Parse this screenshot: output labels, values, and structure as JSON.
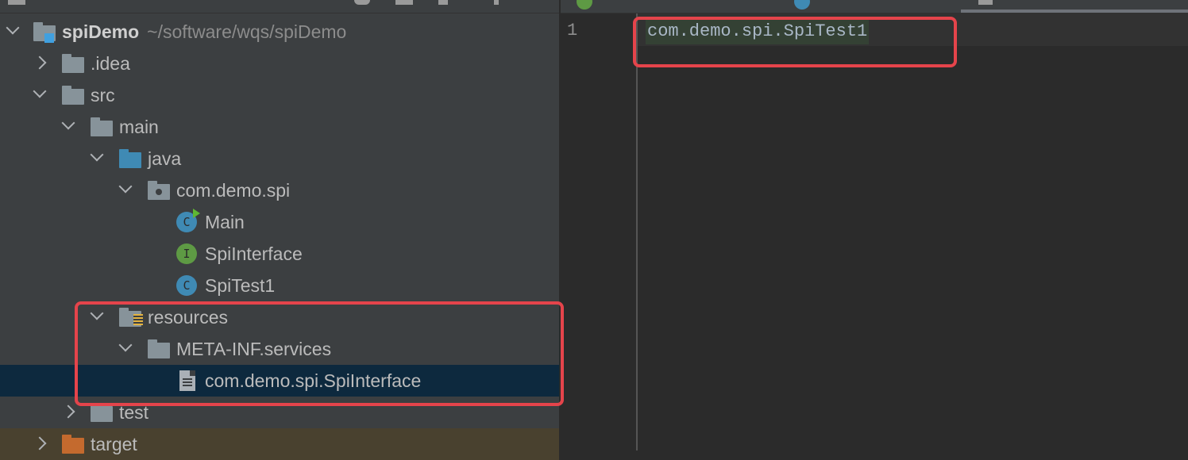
{
  "project_tree": {
    "root": {
      "name": "spiDemo",
      "path": "~/software/wqs/spiDemo"
    },
    "items": [
      {
        "label": ".idea"
      },
      {
        "label": "src"
      },
      {
        "label": "main"
      },
      {
        "label": "java"
      },
      {
        "label": "com.demo.spi"
      },
      {
        "label": "Main",
        "class_letter": "C"
      },
      {
        "label": "SpiInterface",
        "class_letter": "I"
      },
      {
        "label": "SpiTest1",
        "class_letter": "C"
      },
      {
        "label": "resources"
      },
      {
        "label": "META-INF.services"
      },
      {
        "label": "com.demo.spi.SpiInterface",
        "selected": true
      },
      {
        "label": "test"
      },
      {
        "label": "target"
      }
    ]
  },
  "editor": {
    "line_number": "1",
    "line_text": "com.demo.spi.SpiTest1"
  },
  "colors": {
    "panel_bg": "#3c3f41",
    "editor_bg": "#2b2b2b",
    "selection": "#0d293e",
    "highlight_box": "#e5444b"
  }
}
